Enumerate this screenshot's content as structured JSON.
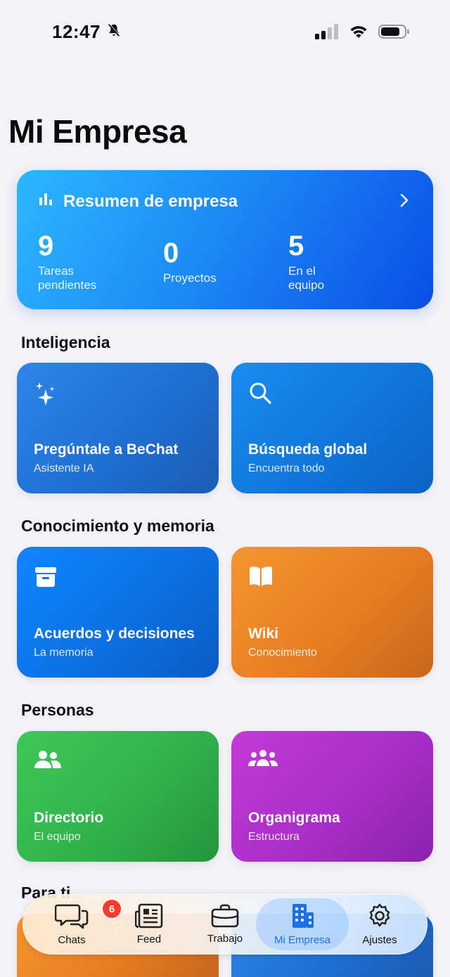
{
  "status_bar": {
    "time": "12:47"
  },
  "page_title": "Mi Empresa",
  "summary": {
    "title": "Resumen de empresa",
    "stats": [
      {
        "value": "9",
        "label": "Tareas pendientes"
      },
      {
        "value": "0",
        "label": "Proyectos"
      },
      {
        "value": "5",
        "label": "En el equipo"
      }
    ]
  },
  "sections": {
    "inteligencia": {
      "title": "Inteligencia",
      "tiles": [
        {
          "name": "Pregúntale a BeChat",
          "sub": "Asistente IA",
          "icon": "sparkles-icon"
        },
        {
          "name": "Búsqueda global",
          "sub": "Encuentra todo",
          "icon": "search-icon"
        }
      ]
    },
    "conocimiento": {
      "title": "Conocimiento y memoria",
      "tiles": [
        {
          "name": "Acuerdos y decisiones",
          "sub": "La memoria",
          "icon": "archive-box-icon"
        },
        {
          "name": "Wiki",
          "sub": "Conocimiento",
          "icon": "book-icon"
        }
      ]
    },
    "personas": {
      "title": "Personas",
      "tiles": [
        {
          "name": "Directorio",
          "sub": "El equipo",
          "icon": "two-people-icon"
        },
        {
          "name": "Organigrama",
          "sub": "Estructura",
          "icon": "three-people-icon"
        }
      ]
    },
    "para_ti": {
      "title": "Para ti"
    }
  },
  "tab_bar": {
    "tabs": [
      {
        "label": "Chats",
        "icon": "chat-bubbles-icon",
        "badge": "6"
      },
      {
        "label": "Feed",
        "icon": "newspaper-icon"
      },
      {
        "label": "Trabajo",
        "icon": "briefcase-icon"
      },
      {
        "label": "Mi Empresa",
        "icon": "building-icon",
        "active": true
      },
      {
        "label": "Ajustes",
        "icon": "gear-icon"
      }
    ]
  },
  "colors": {
    "accent": "#1f6fe5",
    "background": "#f2f2f7",
    "badge": "#ff3b30",
    "orange_tile": "#e87d22",
    "green_tile": "#30b24b",
    "purple_tile": "#a92ec8"
  }
}
